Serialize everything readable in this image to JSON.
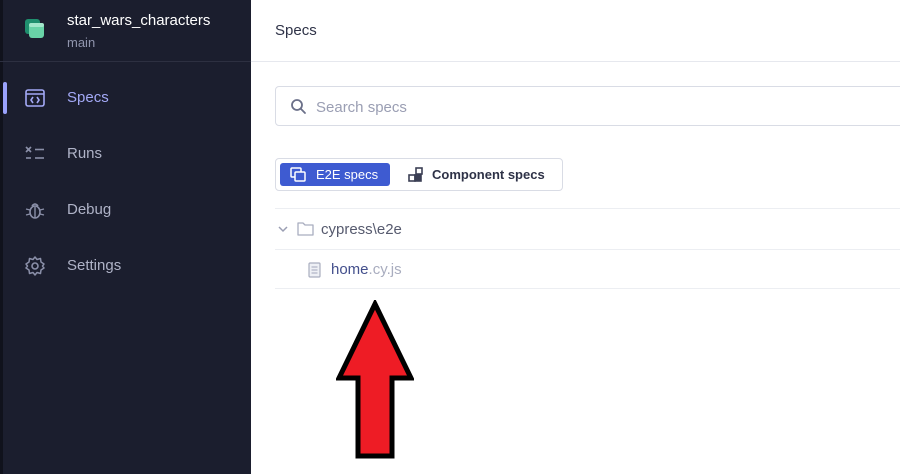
{
  "project": {
    "name": "star_wars_characters",
    "branch": "main"
  },
  "sidebar": {
    "items": [
      {
        "label": "Specs",
        "icon": "code-icon",
        "active": true
      },
      {
        "label": "Runs",
        "icon": "runs-list-icon",
        "active": false
      },
      {
        "label": "Debug",
        "icon": "bug-icon",
        "active": false
      },
      {
        "label": "Settings",
        "icon": "gear-icon",
        "active": false
      }
    ]
  },
  "header": {
    "title": "Specs"
  },
  "search": {
    "placeholder": "Search specs",
    "value": ""
  },
  "testing_type": {
    "e2e_label": "E2E specs",
    "component_label": "Component specs",
    "selected": "E2E specs"
  },
  "spec_tree": {
    "folder": {
      "label": "cypress\\e2e",
      "expanded": true
    },
    "files": [
      {
        "name": "home",
        "extension": ".cy.js"
      }
    ]
  },
  "annotation": {
    "icon": "red-up-arrow",
    "color": "#ee1c25"
  },
  "colors": {
    "sidebar_bg": "#1b1e2e",
    "accent": "#3e5bd1",
    "active_nav": "#a3a9f6"
  }
}
